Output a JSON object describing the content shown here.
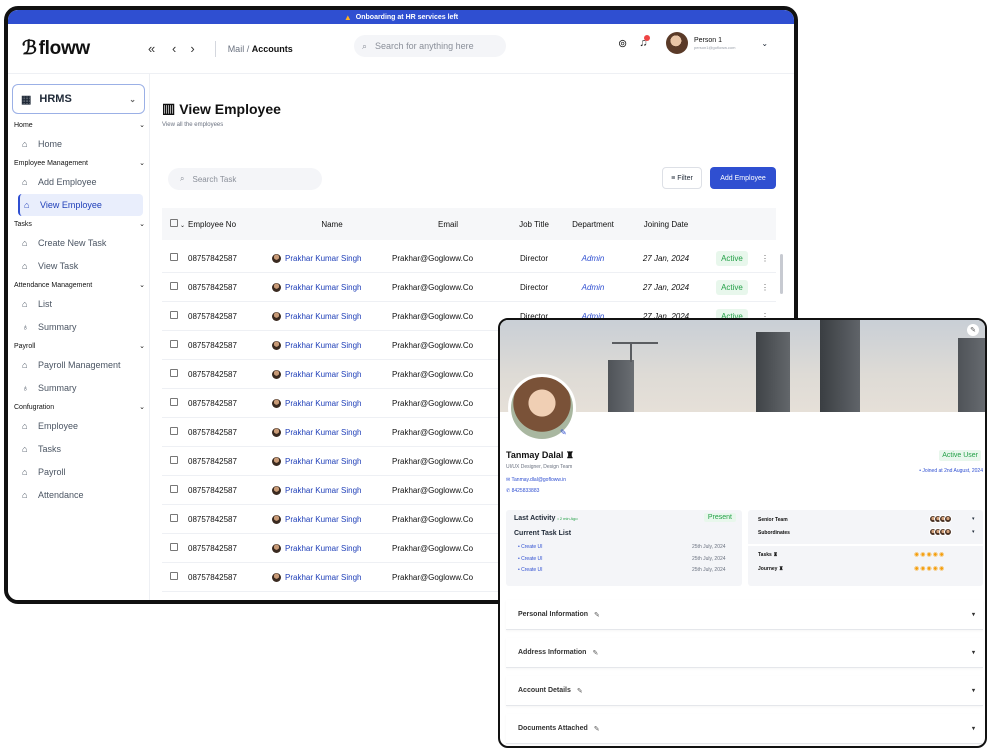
{
  "banner": {
    "text": "Onboarding at HR services left"
  },
  "brand": {
    "name": "floww",
    "logo_glyph": "ℬ"
  },
  "topbar": {
    "collapse_glyph": "«",
    "back_glyph": "‹",
    "forward_glyph": "›",
    "breadcrumb_parent": "Mail",
    "breadcrumb_sep": " / ",
    "breadcrumb_current": "Accounts",
    "search_placeholder": "Search for anything here",
    "user_name": "Person 1",
    "user_email": "person1@gofloww.com"
  },
  "sidebar": {
    "module": "HRMS",
    "sections": [
      {
        "title": "Home",
        "items": [
          "Home"
        ]
      },
      {
        "title": "Employee Management",
        "items": [
          "Add Employee",
          "View Employee"
        ]
      },
      {
        "title": "Tasks",
        "items": [
          "Create New Task",
          "View Task"
        ]
      },
      {
        "title": "Attendance Management",
        "items": [
          "List",
          "Summary"
        ]
      },
      {
        "title": "Payroll",
        "items": [
          "Payroll Management",
          "Summary"
        ]
      },
      {
        "title": "Confugration",
        "items": [
          "Employee",
          "Tasks",
          "Payroll",
          "Attendance"
        ]
      }
    ],
    "active_item": "View Employee"
  },
  "page": {
    "title": "View Employee",
    "subtitle": "View all the employees",
    "task_search_placeholder": "Search Task",
    "filter_label": "Filter",
    "add_label": "Add Employee"
  },
  "table": {
    "columns": [
      "Employee No",
      "Name",
      "Email",
      "Job Title",
      "Department",
      "Joining Date"
    ],
    "rows": [
      [
        "08757842587",
        "Prakhar Kumar Singh",
        "Prakhar@Gogloww.Co",
        "Director",
        "Admin",
        "27 Jan, 2024",
        "Active"
      ],
      [
        "08757842587",
        "Prakhar Kumar Singh",
        "Prakhar@Gogloww.Co",
        "Director",
        "Admin",
        "27 Jan, 2024",
        "Active"
      ],
      [
        "08757842587",
        "Prakhar Kumar Singh",
        "Prakhar@Gogloww.Co",
        "Director",
        "Admin",
        "27 Jan, 2024",
        "Active"
      ],
      [
        "08757842587",
        "Prakhar Kumar Singh",
        "Prakhar@Gogloww.Co",
        "",
        "",
        "",
        ""
      ],
      [
        "08757842587",
        "Prakhar Kumar Singh",
        "Prakhar@Gogloww.Co",
        "",
        "",
        "",
        ""
      ],
      [
        "08757842587",
        "Prakhar Kumar Singh",
        "Prakhar@Gogloww.Co",
        "",
        "",
        "",
        ""
      ],
      [
        "08757842587",
        "Prakhar Kumar Singh",
        "Prakhar@Gogloww.Co",
        "",
        "",
        "",
        ""
      ],
      [
        "08757842587",
        "Prakhar Kumar Singh",
        "Prakhar@Gogloww.Co",
        "",
        "",
        "",
        ""
      ],
      [
        "08757842587",
        "Prakhar Kumar Singh",
        "Prakhar@Gogloww.Co",
        "",
        "",
        "",
        ""
      ],
      [
        "08757842587",
        "Prakhar Kumar Singh",
        "Prakhar@Gogloww.Co",
        "",
        "",
        "",
        ""
      ],
      [
        "08757842587",
        "Prakhar Kumar Singh",
        "Prakhar@Gogloww.Co",
        "",
        "",
        "",
        ""
      ],
      [
        "08757842587",
        "Prakhar Kumar Singh",
        "Prakhar@Gogloww.Co",
        "",
        "",
        "",
        ""
      ]
    ]
  },
  "profile": {
    "name": "Tanmay Dalal",
    "role": "UI/UX Designer, Design Team",
    "email": "Tanmay.dlal@gofloww.in",
    "phone": "8425833883",
    "status": "Active User",
    "joined": "• Joined at 2nd August, 2024",
    "last_activity_label": "Last Activity",
    "last_activity_time": "• 2 min Ago",
    "presence": "Present",
    "task_list_title": "Current Task List",
    "tasks": [
      {
        "name": "• Create UI",
        "date": "25th July, 2024"
      },
      {
        "name": "• Create UI",
        "date": "25th July, 2024"
      },
      {
        "name": "• Create UI",
        "date": "25th July, 2024"
      }
    ],
    "senior_team_label": "Senior Team",
    "subordinates_label": "Subordinates",
    "tasks_label": "Tasks",
    "journey_label": "Journey",
    "sections": [
      "Personal Information",
      "Address Information",
      "Account Details",
      "Documents Attached"
    ]
  },
  "colors": {
    "accent": "#2f4fd1",
    "success": "#22a046",
    "banner": "#2f4fd1"
  }
}
